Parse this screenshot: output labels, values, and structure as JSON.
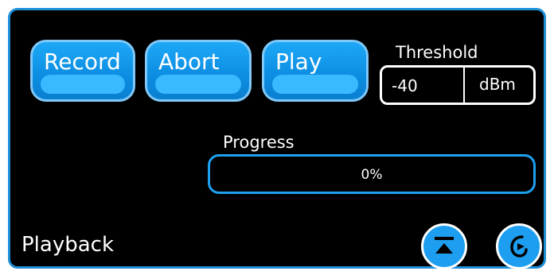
{
  "buttons": {
    "record_label": "Record",
    "abort_label": "Abort",
    "play_label": "Play"
  },
  "threshold": {
    "title": "Threshold",
    "value": "-40",
    "unit": "dBm"
  },
  "progress": {
    "title": "Progress",
    "text": "0%",
    "fraction": 0
  },
  "page": {
    "label": "Playback"
  },
  "nav": {
    "eject_icon": "eject-icon",
    "back_icon": "return-icon"
  },
  "colors": {
    "accent": "#1e9ef0",
    "border": "#1e8fd6",
    "background": "#000000"
  }
}
